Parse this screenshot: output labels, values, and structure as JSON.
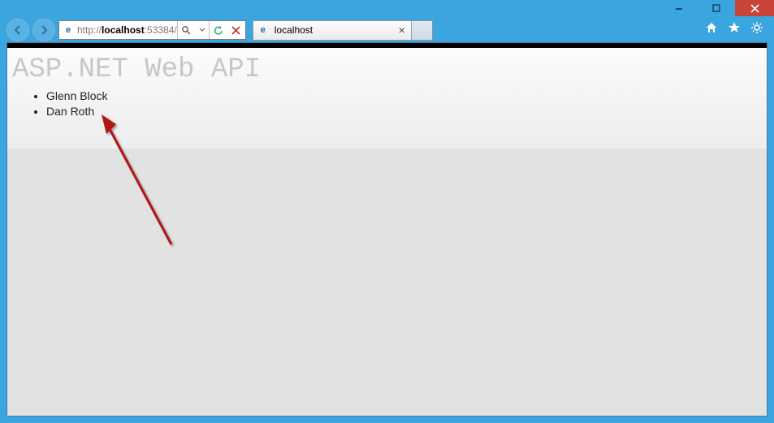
{
  "window": {
    "minimize": "–",
    "maximize": "☐",
    "close": "✕"
  },
  "toolbar": {
    "url_scheme": "http://",
    "url_host": "localhost",
    "url_port_path": ":53384/"
  },
  "tab": {
    "title": "localhost",
    "close": "×"
  },
  "page": {
    "heading": "ASP.NET Web API",
    "items": [
      "Glenn Block",
      "Dan Roth"
    ]
  }
}
